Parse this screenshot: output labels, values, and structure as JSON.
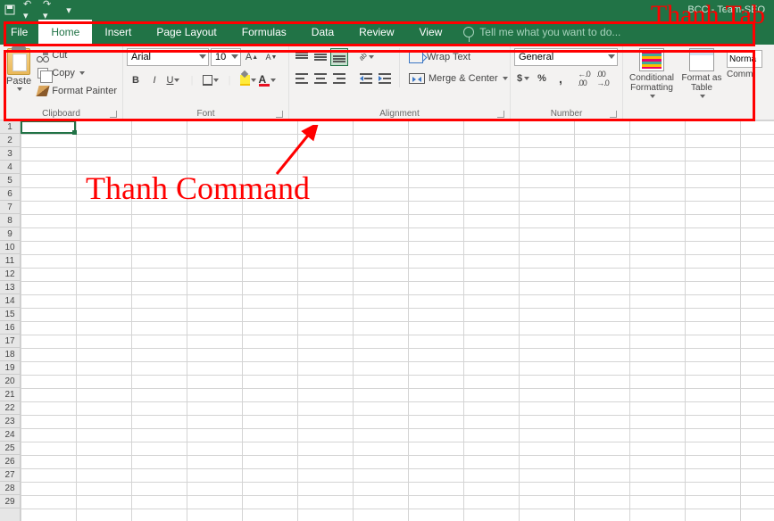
{
  "titlebar": {
    "doc": "BCC - Team-SEO"
  },
  "tabs": {
    "file": "File",
    "home": "Home",
    "insert": "Insert",
    "pageLayout": "Page Layout",
    "formulas": "Formulas",
    "data": "Data",
    "review": "Review",
    "view": "View",
    "tellme": "Tell me what you want to do..."
  },
  "clipboard": {
    "paste": "Paste",
    "cut": "Cut",
    "copy": "Copy",
    "formatPainter": "Format Painter",
    "label": "Clipboard"
  },
  "font": {
    "name": "Arial",
    "size": "10",
    "increaseA": "A",
    "decreaseA": "A",
    "bold": "B",
    "italic": "I",
    "underline": "U",
    "label": "Font"
  },
  "alignment": {
    "wrap": "Wrap Text",
    "merge": "Merge & Center",
    "label": "Alignment"
  },
  "number": {
    "format": "General",
    "label": "Number",
    "incDec": "←.0\n.00",
    "decDec": ".00\n→.0"
  },
  "styles": {
    "conditional": "Conditional Formatting",
    "formatTable": "Format as Table",
    "normal": "Norma",
    "commLabel": "Comm"
  },
  "rows": [
    "1",
    "2",
    "3",
    "4",
    "5",
    "6",
    "7",
    "8",
    "9",
    "10",
    "11",
    "12",
    "13",
    "14",
    "15",
    "16",
    "17",
    "18",
    "19",
    "20",
    "21",
    "22",
    "23",
    "24",
    "25",
    "26",
    "27",
    "28",
    "29"
  ],
  "annotations": {
    "tab": "Thanh Tab",
    "command": "Thanh Command"
  }
}
